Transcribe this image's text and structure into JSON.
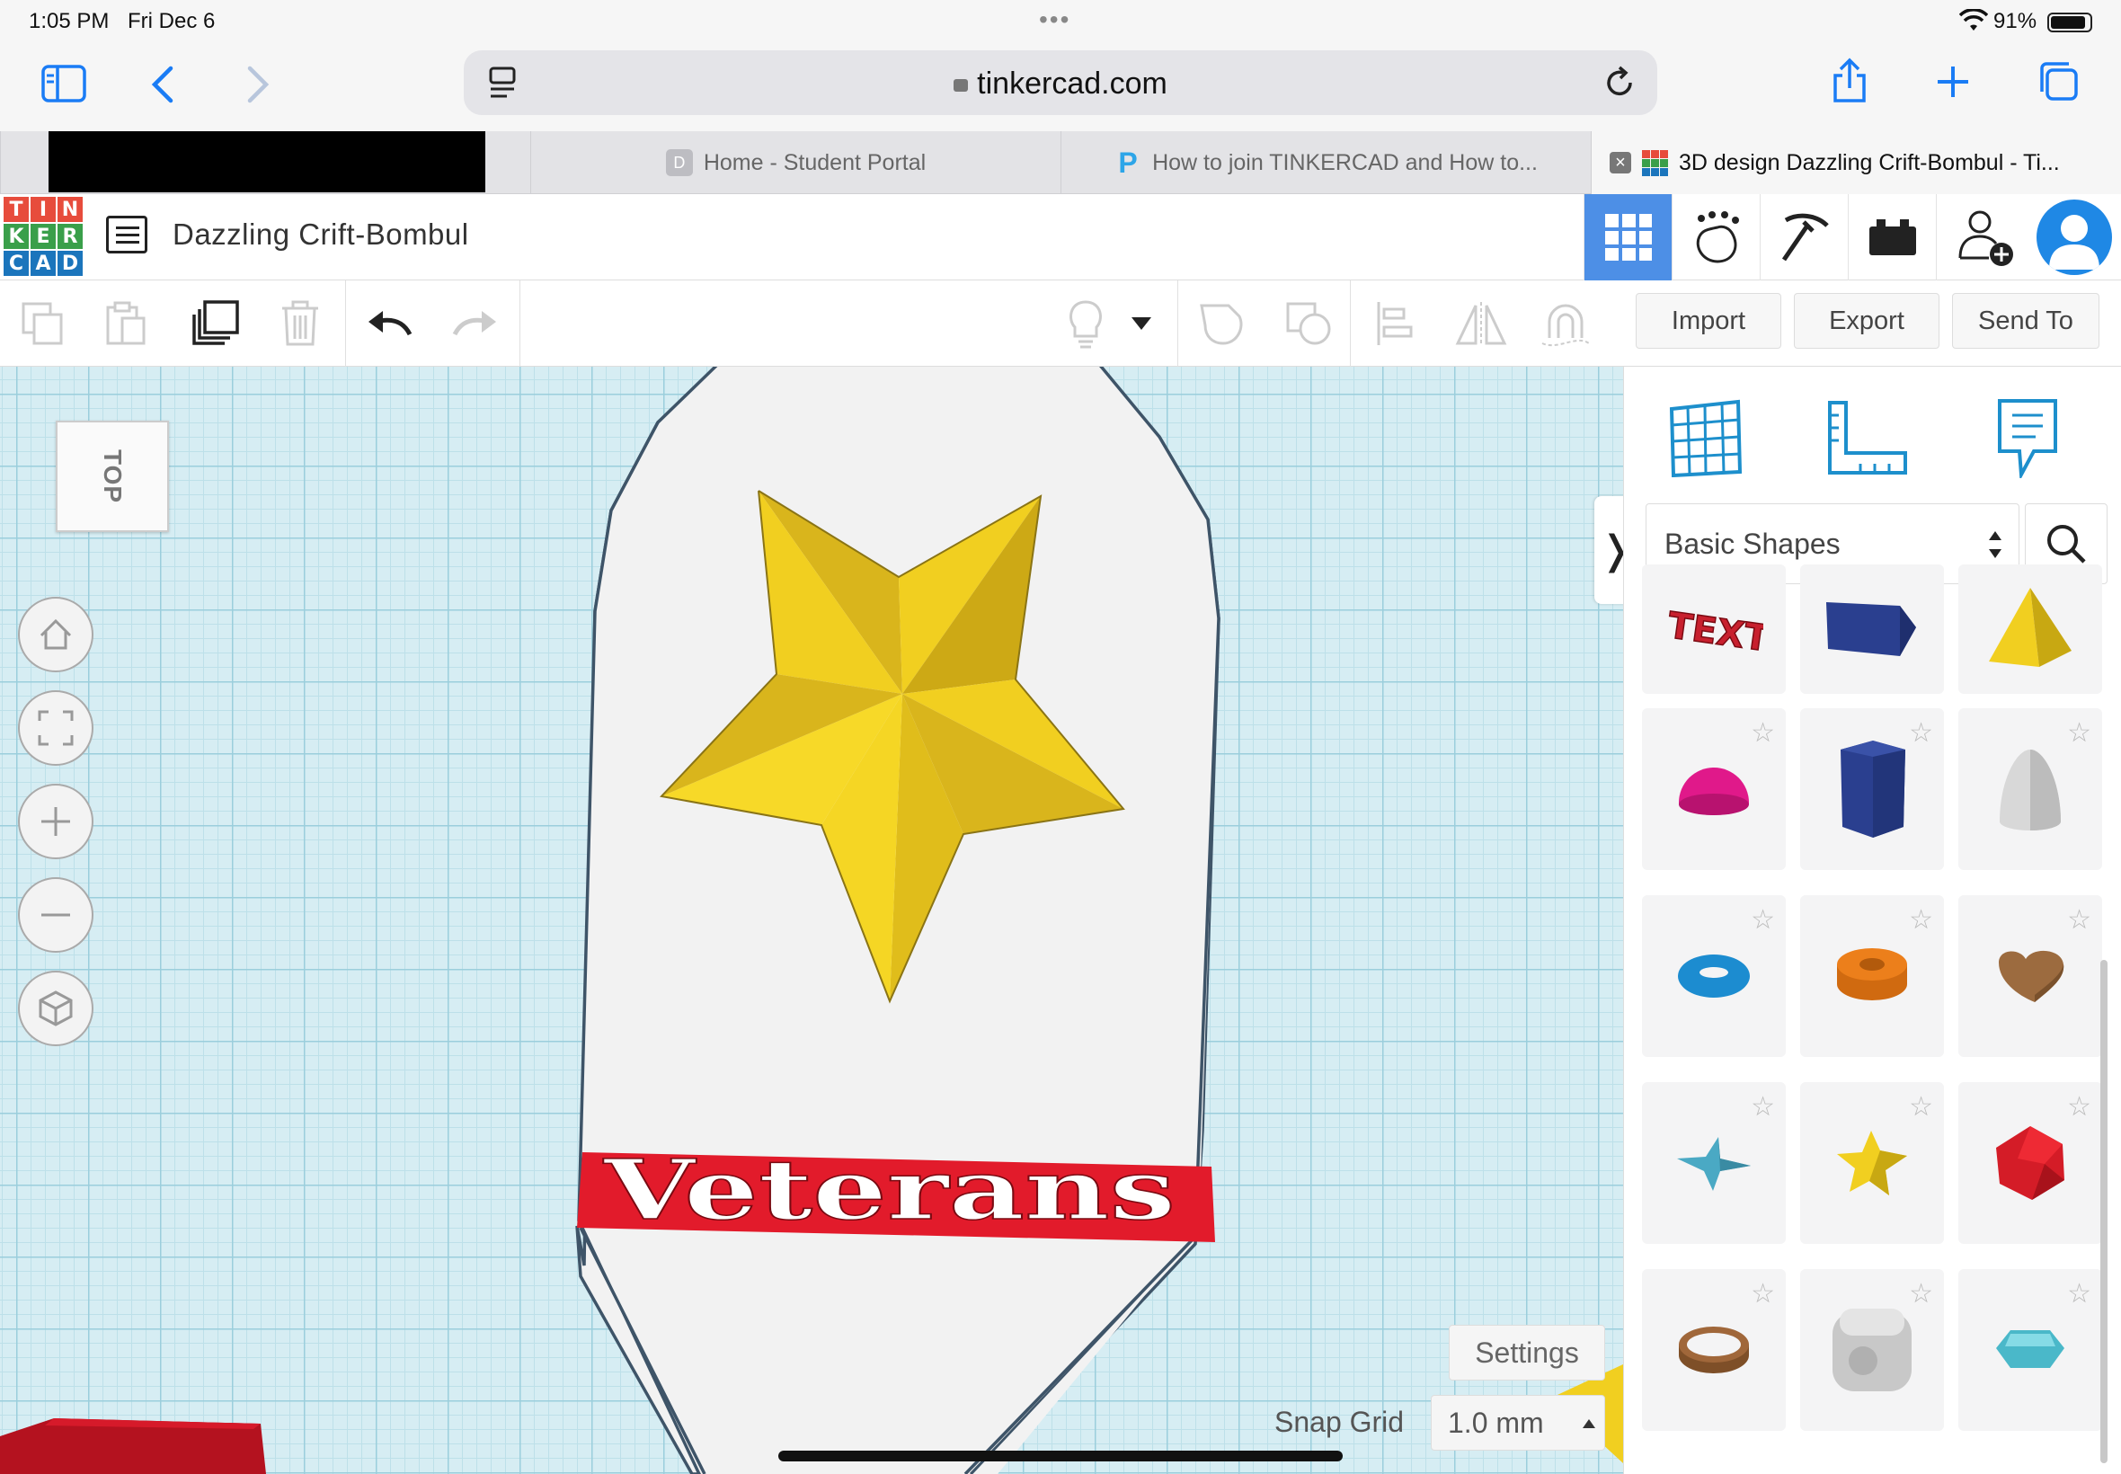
{
  "status": {
    "time": "1:05 PM",
    "date": "Fri Dec 6",
    "battery": "91%"
  },
  "browser": {
    "url": "tinkercad.com"
  },
  "tabs": [
    {
      "label": "",
      "redacted": true
    },
    {
      "label": "Home - Student Portal",
      "favicon": "D"
    },
    {
      "label": "How to join TINKERCAD and How to...",
      "favicon": "P"
    },
    {
      "label": "3D design Dazzling Crift-Bombul - Ti...",
      "favicon": "tinkercad"
    }
  ],
  "app": {
    "logo": [
      "T",
      "I",
      "N",
      "K",
      "E",
      "R",
      "C",
      "A",
      "D"
    ],
    "logo_colors": [
      "#e74c3c",
      "#e74c3c",
      "#e74c3c",
      "#3a9f4a",
      "#3a9f4a",
      "#3a9f4a",
      "#1b75bc",
      "#1b75bc",
      "#1b75bc"
    ],
    "design_title": "Dazzling Crift-Bombul"
  },
  "toolbar": {
    "import": "Import",
    "export": "Export",
    "send_to": "Send To"
  },
  "workplane": {
    "viewcube": "TOP",
    "banner_text": "Veterans",
    "settings": "Settings",
    "snap_label": "Snap Grid",
    "snap_value": "1.0 mm"
  },
  "panel": {
    "category": "Basic Shapes",
    "shapes": [
      {
        "name": "text",
        "color": "#c8202e"
      },
      {
        "name": "box",
        "color": "#2a3f8f"
      },
      {
        "name": "pyramid",
        "color": "#e6c21a"
      },
      {
        "name": "half-sphere",
        "color": "#e0198a"
      },
      {
        "name": "polygon",
        "color": "#2a3f8f"
      },
      {
        "name": "paraboloid",
        "color": "#d8d8d8"
      },
      {
        "name": "torus",
        "color": "#1c8cd0"
      },
      {
        "name": "tube",
        "color": "#ec7f1b"
      },
      {
        "name": "heart",
        "color": "#9c6b3f"
      },
      {
        "name": "star",
        "color": "#4aa9c4"
      },
      {
        "name": "star-gold",
        "color": "#e6c21a"
      },
      {
        "name": "icosahedron",
        "color": "#d41c27"
      },
      {
        "name": "ring",
        "color": "#a0673a"
      },
      {
        "name": "rounded-box",
        "color": "#c8c8c8"
      },
      {
        "name": "gem",
        "color": "#4ab8c9"
      }
    ]
  },
  "colors": {
    "accent": "#1a7cf5",
    "active_view": "#4d8fe6",
    "grid": "#d6edf3",
    "banner": "#e21b2b",
    "star": "#f1cf20"
  }
}
